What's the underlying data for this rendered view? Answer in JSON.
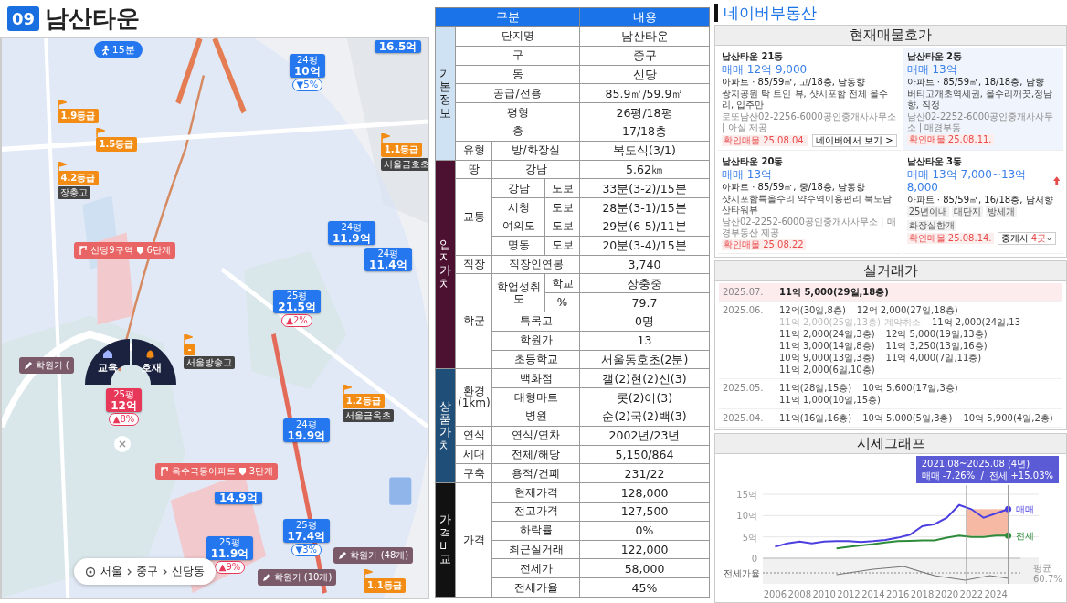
{
  "title": {
    "number": "09",
    "text": "남산타운"
  },
  "map": {
    "walk_badge": "15분",
    "breadcrumb": [
      "서울",
      "중구",
      "신당동"
    ],
    "dial": {
      "left": "교육",
      "right": "호재"
    },
    "selected": {
      "size": "25평",
      "price": "12억",
      "change": "▲8%",
      "color": "#e8385a"
    },
    "price_markers": [
      {
        "price": "16.5억"
      },
      {
        "size": "24평",
        "price": "10억",
        "change": "▼5%",
        "color": "#2477ee"
      },
      {
        "size": "24평",
        "price": "11.9억"
      },
      {
        "size": "24평",
        "price": "11.4억"
      },
      {
        "size": "25평",
        "price": "21.5억",
        "change": "▲2%",
        "color": "#e8385a"
      },
      {
        "size": "24평",
        "price": "19.9억"
      },
      {
        "price": "14.9억"
      },
      {
        "size": "25평",
        "price": "17.4억",
        "change": "▼3%",
        "color": "#2477ee"
      },
      {
        "size": "25평",
        "price": "11.9억",
        "change": "▲9%",
        "color": "#e8385a"
      }
    ],
    "grade_flags": [
      {
        "label": "1.9등급"
      },
      {
        "label": "1.5등급"
      },
      {
        "label": "4.2등급",
        "school": "장충고"
      },
      {
        "label": "1.1등급",
        "school": "서울금호초"
      },
      {
        "label": "-",
        "school": "서울방송고"
      },
      {
        "label": "1.2등급",
        "school": "서울금옥초"
      },
      {
        "label": "1.1등급"
      }
    ],
    "academies": [
      "학원가 (",
      "학원가 (10개)",
      "학원가 (48개)"
    ],
    "redevelopments": [
      {
        "name": "신당9구역",
        "stage": "6단계"
      },
      {
        "name": "옥수극동아파트",
        "stage": "3단계"
      }
    ]
  },
  "table": {
    "columns": [
      "구분",
      "내용"
    ],
    "groups": [
      {
        "label": "기본정보",
        "color": "#cfe2f3",
        "items": [
          {
            "label": "단지명",
            "value": "남산타운"
          },
          {
            "label": "구",
            "value": "중구"
          },
          {
            "label": "동",
            "value": "신당"
          },
          {
            "label": "공급/전용",
            "value": "85.9㎡/59.9㎡"
          },
          {
            "label": "평형",
            "value": "26평/18평"
          },
          {
            "label": "층",
            "value": "17/18층"
          },
          {
            "label": "유형",
            "sub": [
              {
                "label": "방/화장실",
                "value": "복도식(3/1)"
              }
            ]
          }
        ]
      },
      {
        "label": "입지가치",
        "color": "#4c1130",
        "items": [
          {
            "label": "땅",
            "sub": [
              {
                "label": "강남",
                "value": "5.62㎞"
              }
            ]
          },
          {
            "label": "교통",
            "sub": [
              {
                "label": "강남",
                "sub": [
                  {
                    "label": "도보",
                    "value": "33분(3-2)/15분"
                  }
                ]
              },
              {
                "label": "시청",
                "sub": [
                  {
                    "label": "도보",
                    "value": "28분(3-1)/15분"
                  }
                ]
              },
              {
                "label": "여의도",
                "sub": [
                  {
                    "label": "도보",
                    "value": "29분(6-5)/11분"
                  }
                ]
              },
              {
                "label": "명동",
                "sub": [
                  {
                    "label": "도보",
                    "value": "20분(3-4)/15분"
                  }
                ]
              }
            ]
          },
          {
            "label": "직장",
            "sub": [
              {
                "label": "직장인연봉",
                "value": "3,740"
              }
            ]
          },
          {
            "label": "학군",
            "sub": [
              {
                "label": "학업성취도",
                "sub": [
                  {
                    "label": "학교",
                    "value": "장충중"
                  },
                  {
                    "label": "%",
                    "value": "79.7"
                  }
                ]
              },
              {
                "label": "특목고",
                "value": "0명"
              },
              {
                "label": "학원가",
                "value": "13"
              },
              {
                "label": "초등학교",
                "value": "서울동호초(2분)"
              }
            ]
          }
        ]
      },
      {
        "label": "상품가치",
        "color": "#1f4e79",
        "items": [
          {
            "label": "환경(1km)",
            "sub": [
              {
                "label": "백화점",
                "value": "갤(2)현(2)신(3)"
              },
              {
                "label": "대형마트",
                "value": "롯(2)이(3)"
              },
              {
                "label": "병원",
                "value": "순(2)국(2)백(3)"
              }
            ]
          },
          {
            "label": "연식",
            "sub": [
              {
                "label": "연식/연차",
                "value": "2002년/23년"
              }
            ]
          },
          {
            "label": "세대",
            "sub": [
              {
                "label": "전체/해당",
                "value": "5,150/864"
              }
            ]
          },
          {
            "label": "구축",
            "sub": [
              {
                "label": "용적/건폐",
                "value": "231/22"
              }
            ]
          }
        ]
      },
      {
        "label": "가격비교",
        "color": "#111111",
        "items": [
          {
            "label": "가격",
            "sub": [
              {
                "label": "현재가격",
                "value": "128,000"
              },
              {
                "label": "전고가격",
                "value": "127,500"
              },
              {
                "label": "하락률",
                "value": "0%"
              },
              {
                "label": "최근실거래",
                "value": "122,000"
              },
              {
                "label": "전세가",
                "value": "58,000"
              },
              {
                "label": "전세가율",
                "value": "45%"
              }
            ]
          }
        ]
      }
    ]
  },
  "naver": {
    "brand": "네이버부동산",
    "listings": {
      "title": "현재매물호가",
      "items": [
        {
          "name": "남산타운 21동",
          "price": "매매 12억 9,000",
          "price_up": false,
          "highlighted": false,
          "specs": "아파트 · 85/59㎡, 고/18층, 남동향",
          "description": "쌍지공원 탁 트인 뷰, 샷시포함 전체 올수리, 입주만",
          "agency": "로또남산02-2256-6000공인중개사사무소 | 아실 제공",
          "confirmed": "확인매물 25.08.04.",
          "link": "네이버에서 보기 >"
        },
        {
          "name": "남산타운 2동",
          "price": "매매 13억",
          "price_up": false,
          "highlighted": true,
          "specs": "아파트 · 85/59㎡, 18/18층, 남향",
          "description": "버티고개초역세권, 올수리깨끗,정남향, 직정",
          "agency": "남산02-2252-6000공인중개사사무소 | 매경부동",
          "confirmed": "확인매물 25.08.11."
        },
        {
          "name": "남산타운 20동",
          "price": "매매 13억",
          "price_up": false,
          "highlighted": false,
          "specs": "아파트 · 85/59㎡, 중/18층, 남동향",
          "description": "샷시포함특올수리 약수역이용편리 북도남산타워뷰",
          "agency": "남산02-2252-6000공인중개사사무소 | 매경부동산 제공",
          "confirmed": "확인매물 25.08.22"
        },
        {
          "name": "남산타운 3동",
          "price": "매매 13억 7,000~13억 8,000",
          "price_up": true,
          "highlighted": false,
          "specs": "아파트 · 85/59㎡, 16/18층, 남서향",
          "tags": [
            "25년이내",
            "대단지",
            "방세개",
            "화장실한개"
          ],
          "confirmed": "확인매물 25.08.14.",
          "agents": {
            "label": "중개사",
            "count": "4곳"
          }
        }
      ]
    },
    "trades": {
      "title": "실거래가",
      "months": [
        {
          "month": "2025.07.",
          "highlighted": true,
          "items": [
            {
              "text": "11억 5,000(29일,18층)",
              "cancelled": false
            }
          ]
        },
        {
          "month": "2025.06.",
          "highlighted": false,
          "items": [
            {
              "text": "12억(30일,8층)",
              "cancelled": false
            },
            {
              "text": "12억 2,000(27일,18층)",
              "cancelled": false
            },
            {
              "text": "11억 2,000(25일,13층)",
              "cancelled": true,
              "note": "계약취소"
            },
            {
              "text": "11억 2,000(24일,13",
              "cancelled": false
            },
            {
              "text": "11억 2,000(24일,3층)",
              "cancelled": false
            },
            {
              "text": "12억 5,000(19일,13층)",
              "cancelled": false
            },
            {
              "text": "11억 3,000(14일,8층)",
              "cancelled": false
            },
            {
              "text": "11억 3,250(13일,16층)",
              "cancelled": false
            },
            {
              "text": "10억 9,000(13일,3층)",
              "cancelled": false
            },
            {
              "text": "11억 4,000(7일,11층)",
              "cancelled": false
            },
            {
              "text": "11억 2,000(6일,10층)",
              "cancelled": false
            }
          ]
        },
        {
          "month": "2025.05.",
          "highlighted": false,
          "items": [
            {
              "text": "11억(28일,15층)",
              "cancelled": false
            },
            {
              "text": "10억 5,600(17일,3층)",
              "cancelled": false
            },
            {
              "text": "11억 1,000(10일,15층)",
              "cancelled": false
            }
          ]
        },
        {
          "month": "2025.04.",
          "highlighted": false,
          "items": [
            {
              "text": "11억(16일,16층)",
              "cancelled": false
            },
            {
              "text": "10억 5,000(5일,3층)",
              "cancelled": false
            },
            {
              "text": "10억 5,900(4일,2층)",
              "cancelled": false
            }
          ]
        }
      ]
    },
    "chart": {
      "title": "시세그래프",
      "tooltip": {
        "range": "2021.08~2025.08 (4년)",
        "summary": "매매 -7.26%  /  전세 +15.03%"
      },
      "ratio_label": "전세가율",
      "average_label": "평균",
      "average_value": "60.7%",
      "chart_data": {
        "type": "line",
        "x": [
          2006,
          2007,
          2008,
          2009,
          2010,
          2011,
          2012,
          2013,
          2014,
          2015,
          2016,
          2017,
          2018,
          2019,
          2020,
          2021,
          2022,
          2023,
          2024,
          2025
        ],
        "series": [
          {
            "name": "매매",
            "color": "#4b3fe0",
            "values": [
              2.7,
              3.5,
              3.9,
              3.5,
              3.9,
              4.0,
              4.0,
              3.8,
              4.0,
              4.3,
              4.8,
              5.5,
              7.5,
              8.0,
              9.5,
              12.5,
              11.5,
              9.5,
              10.5,
              11.5
            ]
          },
          {
            "name": "전세",
            "color": "#2e8b3a",
            "values": [
              null,
              null,
              null,
              null,
              null,
              2.3,
              2.7,
              3.0,
              3.3,
              3.7,
              4.0,
              4.1,
              4.2,
              4.2,
              4.8,
              5.3,
              5.0,
              5.0,
              5.3,
              5.3
            ]
          }
        ],
        "xlim": [
          2005,
          2026
        ],
        "ylim": [
          0,
          15
        ],
        "legend": "right",
        "xticks": [
          2006,
          2008,
          2010,
          2012,
          2014,
          2016,
          2018,
          2020,
          2022,
          2024
        ],
        "yticks": [
          {
            "value": 0,
            "label": "0"
          },
          {
            "value": 5,
            "label": "5억"
          },
          {
            "value": 10,
            "label": "10억"
          },
          {
            "value": 15,
            "label": "15억"
          }
        ]
      }
    }
  }
}
